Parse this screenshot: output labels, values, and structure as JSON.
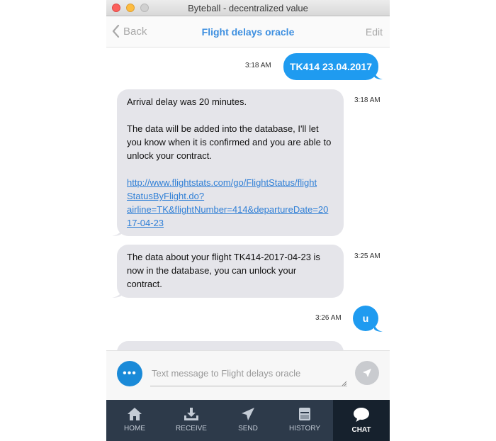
{
  "window": {
    "title": "Byteball - decentralized value"
  },
  "nav": {
    "back_label": "Back",
    "title": "Flight delays oracle",
    "edit_label": "Edit"
  },
  "messages": [
    {
      "direction": "out",
      "time": "3:18 AM",
      "text": "TK414 23.04.2017"
    },
    {
      "direction": "in",
      "time": "3:18 AM",
      "line1": "Arrival delay was 20 minutes.",
      "line2": "The data will be added into the database, I'll let",
      "line3": "you know when it is confirmed and you are able to",
      "line4": "unlock your contract.",
      "link1": "http://www.flightstats.com/go/FlightStatus/flight",
      "link2": "StatusByFlight.do?",
      "link3": "airline=TK&flightNumber=414&departureDate=20",
      "link4": "17-04-23"
    },
    {
      "direction": "in",
      "time": "3:25 AM",
      "line1": "The data about your flight TK414-2017-04-23 is",
      "line2": "now in the database, you can unlock your",
      "line3": "contract."
    },
    {
      "direction": "out",
      "time": "3:26 AM",
      "text": "u"
    }
  ],
  "composer": {
    "placeholder": "Text message to Flight delays oracle"
  },
  "tabs": [
    {
      "label": "HOME",
      "icon": "home-icon"
    },
    {
      "label": "RECEIVE",
      "icon": "receive-icon"
    },
    {
      "label": "SEND",
      "icon": "send-icon"
    },
    {
      "label": "HISTORY",
      "icon": "history-icon"
    },
    {
      "label": "CHAT",
      "icon": "chat-icon",
      "active": true
    }
  ]
}
